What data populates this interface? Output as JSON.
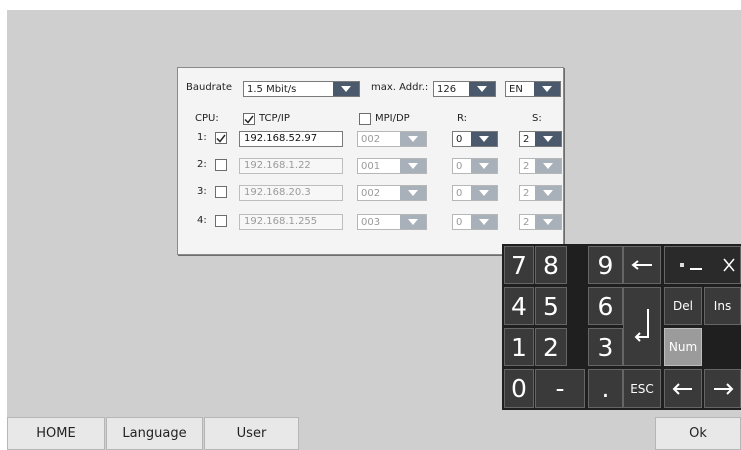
{
  "dialog": {
    "baudrate_label": "Baudrate",
    "baudrate_value": "1.5 Mbit/s",
    "max_addr_label": "max. Addr.:",
    "max_addr_value": "126",
    "language_value": "EN",
    "cpu_label": "CPU:",
    "tcpip_label": "TCP/IP",
    "mpidp_label": "MPI/DP",
    "r_label": "R:",
    "s_label": "S:",
    "rows": [
      {
        "label": "1:",
        "ip": "192.168.52.97",
        "mpi": "002",
        "r": "0",
        "s": "2"
      },
      {
        "label": "2:",
        "ip": "192.168.1.22",
        "mpi": "001",
        "r": "0",
        "s": "2"
      },
      {
        "label": "3:",
        "ip": "192.168.20.3",
        "mpi": "002",
        "r": "0",
        "s": "2"
      },
      {
        "label": "4:",
        "ip": "192.168.1.255",
        "mpi": "003",
        "r": "0",
        "s": "2"
      }
    ]
  },
  "keypad": {
    "digits": [
      "7",
      "8",
      "9",
      "4",
      "5",
      "6",
      "1",
      "2",
      "3",
      "0"
    ],
    "minus": "-",
    "dot": ".",
    "esc": "ESC",
    "del": "Del",
    "ins": "Ins",
    "num": "Num"
  },
  "bottom": {
    "home": "HOME",
    "language": "Language",
    "user": "User",
    "ok": "Ok"
  }
}
